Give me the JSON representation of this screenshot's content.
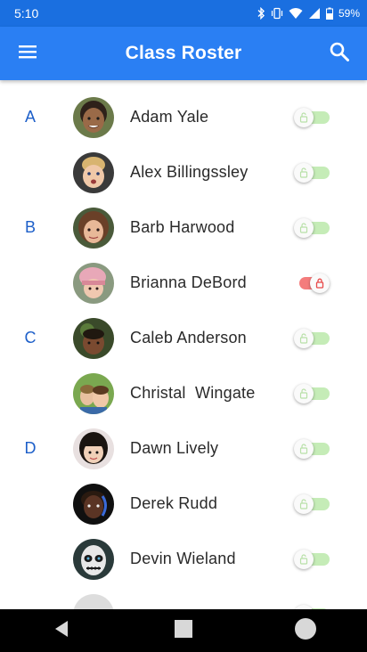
{
  "status_bar": {
    "time": "5:10",
    "battery": "59%"
  },
  "app_bar": {
    "title": "Class Roster",
    "menu_icon": "menu-icon",
    "search_icon": "search-icon"
  },
  "colors": {
    "primary": "#2a7ff3",
    "status": "#1a6fe0",
    "letter": "#1d5fc9",
    "toggle_off": "#c5ecb7",
    "toggle_on": "#f47c7c"
  },
  "students": [
    {
      "letter": "A",
      "name": "Adam Yale",
      "locked": false
    },
    {
      "letter": "",
      "name": "Alex Billingssley",
      "locked": false
    },
    {
      "letter": "B",
      "name": "Barb Harwood",
      "locked": false
    },
    {
      "letter": "",
      "name": "Brianna DeBord",
      "locked": true
    },
    {
      "letter": "C",
      "name": "Caleb Anderson",
      "locked": false
    },
    {
      "letter": "",
      "name": "Christal  Wingate",
      "locked": false
    },
    {
      "letter": "D",
      "name": "Dawn Lively",
      "locked": false
    },
    {
      "letter": "",
      "name": "Derek Rudd",
      "locked": false
    },
    {
      "letter": "",
      "name": "Devin Wieland",
      "locked": false
    }
  ]
}
